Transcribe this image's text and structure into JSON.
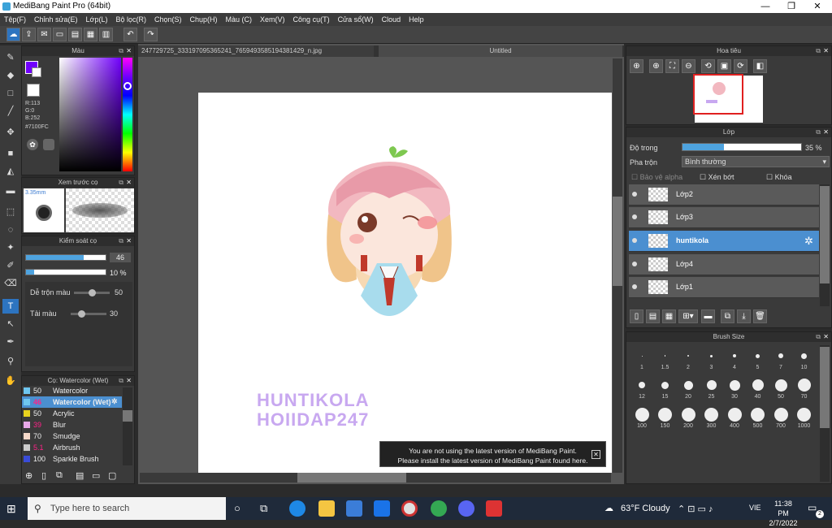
{
  "app": {
    "title": "MediBang Paint Pro (64bit)"
  },
  "window_controls": {
    "minimize": "—",
    "maximize": "❐",
    "close": "✕"
  },
  "menu": [
    "Tệp(F)",
    "Chỉnh sửa(E)",
    "Lớp(L)",
    "Bộ lọc(R)",
    "Chọn(S)",
    "Chụp(H)",
    "Màu (C)",
    "Xem(V)",
    "Công cụ(T)",
    "Cửa sổ(W)",
    "Cloud",
    "Help"
  ],
  "tabs": {
    "file": "247729725_333197095365241_7659493585194381429_n.jpg",
    "untitled": "Untitled"
  },
  "color_panel": {
    "title": "Màu",
    "r": "R:113",
    "g": "G:0",
    "b": "B:252",
    "hex": "#7100FC",
    "primary": "#7100FC"
  },
  "brush_preview": {
    "title": "Xem trước cọ",
    "size": "3.35mm"
  },
  "brush_control": {
    "title": "Kiểm soát cọ",
    "size_value": "46",
    "opacity_value": "10 %",
    "blend_label": "Dễ trộn màu",
    "blend_value": "50",
    "amount_label": "Tải màu",
    "amount_value": "30",
    "size_fraction": 0.72,
    "opacity_fraction": 0.1,
    "blend_fraction": 0.5,
    "amount_fraction": 0.3
  },
  "brush_list": {
    "title": "Cọ: Watercolor (Wet)",
    "items": [
      {
        "size": "50",
        "name": "Watercolor",
        "color": "#6ec6f0"
      },
      {
        "size": "46",
        "name": "Watercolor (Wet)",
        "color": "#6ec6f0",
        "selected": true
      },
      {
        "size": "50",
        "name": "Acrylic",
        "color": "#e8d21e"
      },
      {
        "size": "39",
        "name": "Blur",
        "color": "#e8a8e8"
      },
      {
        "size": "70",
        "name": "Smudge",
        "color": "#f5d8c8"
      },
      {
        "size": "5.1",
        "name": "Airbrush",
        "color": "#cccccc"
      },
      {
        "size": "100",
        "name": "Sparkle Brush",
        "color": "#3a4cd8"
      }
    ]
  },
  "navigator": {
    "title": "Hoa tiêu"
  },
  "layer_panel": {
    "title": "Lớp",
    "opacity_label": "Độ trong",
    "opacity_value": "35 %",
    "opacity_fraction": 0.35,
    "blend_label": "Pha trộn",
    "blend_value": "Bình thường",
    "protect_alpha": "Bảo vệ alpha",
    "clip": "Xén bớt",
    "lock": "Khóa",
    "layers": [
      {
        "name": "Lớp2"
      },
      {
        "name": "Lớp3"
      },
      {
        "name": "huntikola",
        "selected": true
      },
      {
        "name": "Lớp4"
      },
      {
        "name": "Lớp1"
      }
    ]
  },
  "brush_size": {
    "title": "Brush Size",
    "sizes": [
      "1",
      "1.5",
      "2",
      "3",
      "4",
      "5",
      "7",
      "10",
      "12",
      "15",
      "20",
      "25",
      "30",
      "40",
      "50",
      "70",
      "100",
      "150",
      "200",
      "300",
      "400",
      "500",
      "700",
      "1000"
    ]
  },
  "canvas_text": {
    "line1": "HUNTIKOLA",
    "line2": "HOIIDAP247"
  },
  "notice": {
    "line1": "You are not using the latest version of MediBang Paint.",
    "line2": "Please install the latest version of MediBang Paint found here."
  },
  "taskbar": {
    "search_placeholder": "Type here to search",
    "weather": "63°F Cloudy",
    "lang": "VIE",
    "time": "11:38 PM",
    "date": "2/7/2022",
    "notif": "2"
  }
}
